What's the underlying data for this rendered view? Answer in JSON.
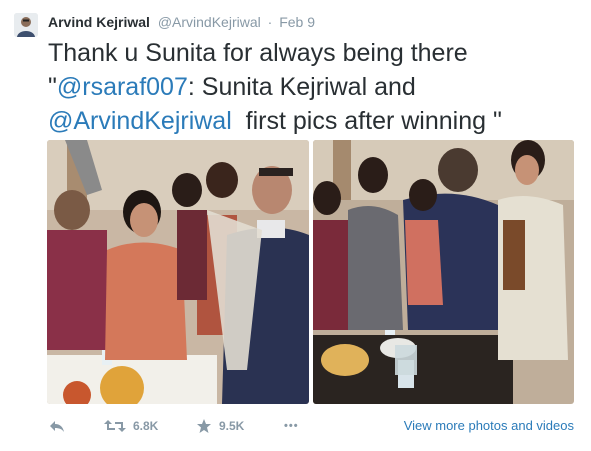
{
  "tweet": {
    "author_name": "Arvind Kejriwal",
    "author_handle": "@ArvindKejriwal",
    "separator": "·",
    "date": "Feb 9",
    "text_line1": "Thank u Sunita for always being there",
    "text_quote_open": "\"",
    "mention1": "@rsaraf007",
    "text_mid": ": Sunita Kejriwal and",
    "mention2": "@ArvindKejriwal",
    "text_end": "  first pics after winning \""
  },
  "actions": {
    "retweet_count": "6.8K",
    "favorite_count": "9.5K",
    "more_glyph": "•••",
    "view_more_label": "View more photos and videos"
  },
  "colors": {
    "link": "#2b7bb9",
    "meta": "#8899a6",
    "text": "#292f33"
  }
}
